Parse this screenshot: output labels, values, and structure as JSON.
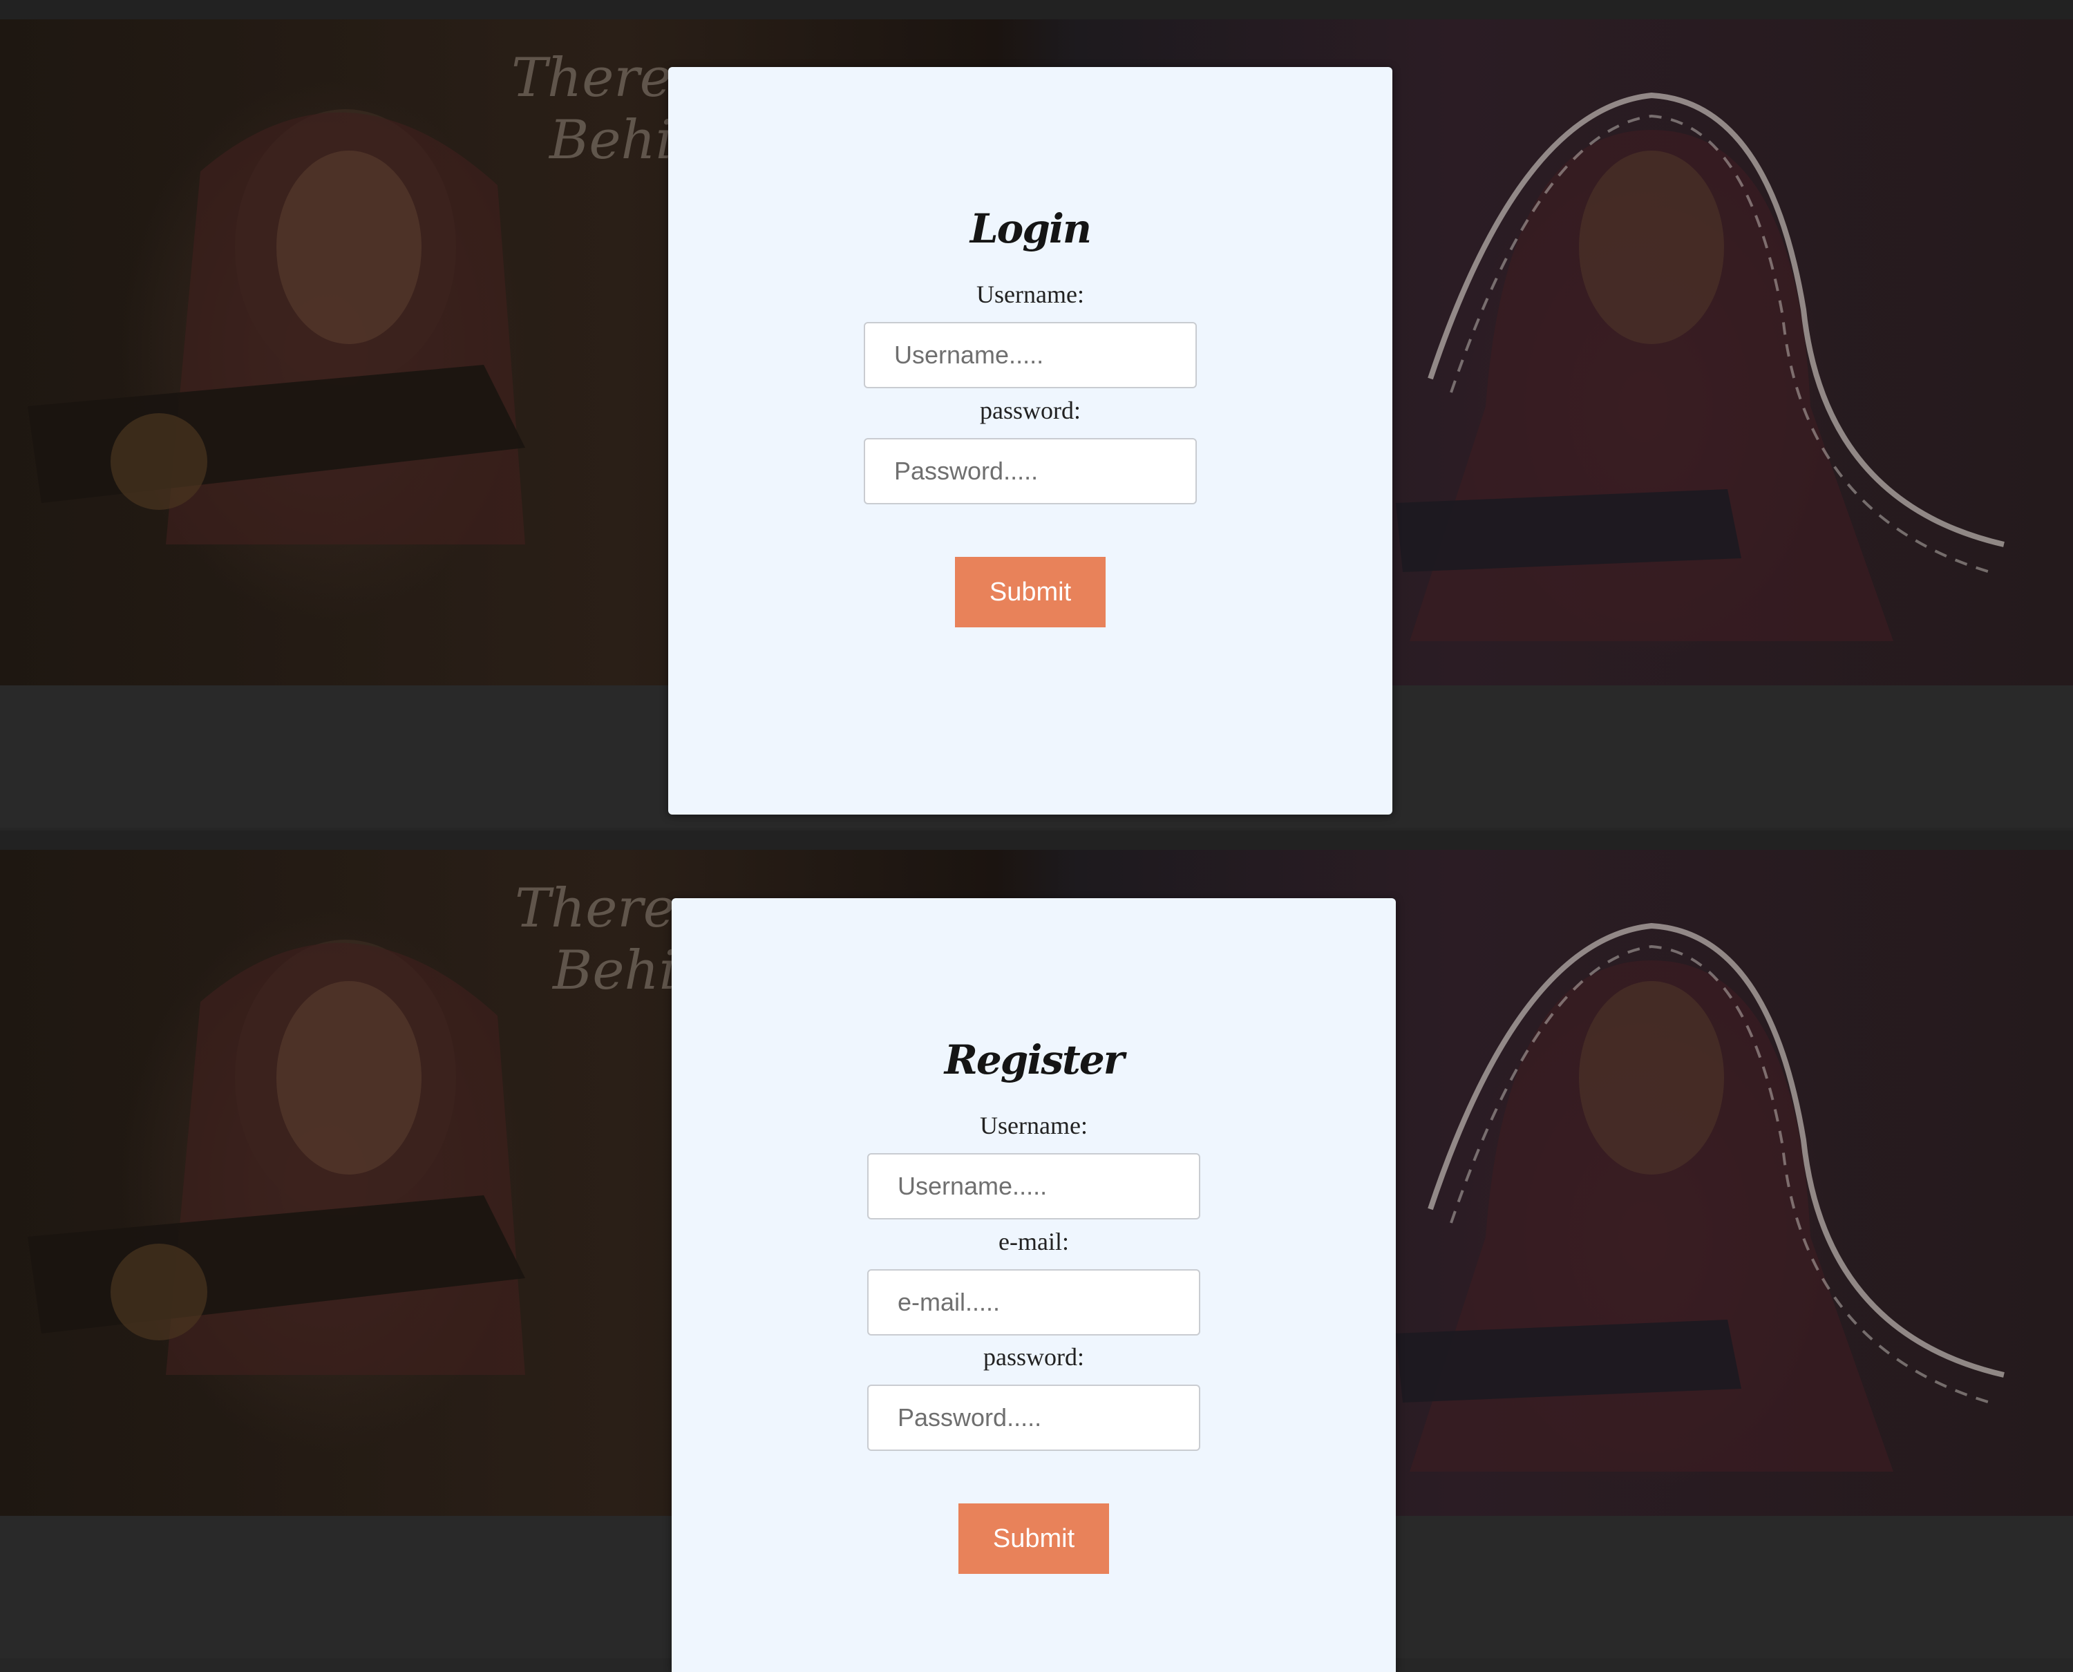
{
  "login": {
    "title": "Login",
    "username_label": "Username:",
    "username_placeholder": "Username.....",
    "password_label": "password:",
    "password_placeholder": "Password.....",
    "submit_label": "Submit"
  },
  "register": {
    "title": "Register",
    "username_label": "Username:",
    "username_placeholder": "Username.....",
    "email_label": "e-mail:",
    "email_placeholder": "e-mail.....",
    "password_label": "password:",
    "password_placeholder": "Password.....",
    "submit_label": "Submit"
  },
  "hero": {
    "line1": "There",
    "line2": "Behi"
  },
  "colors": {
    "card_background": "#eff6fe",
    "submit_button": "#e8825a",
    "page_background": "#262626"
  }
}
